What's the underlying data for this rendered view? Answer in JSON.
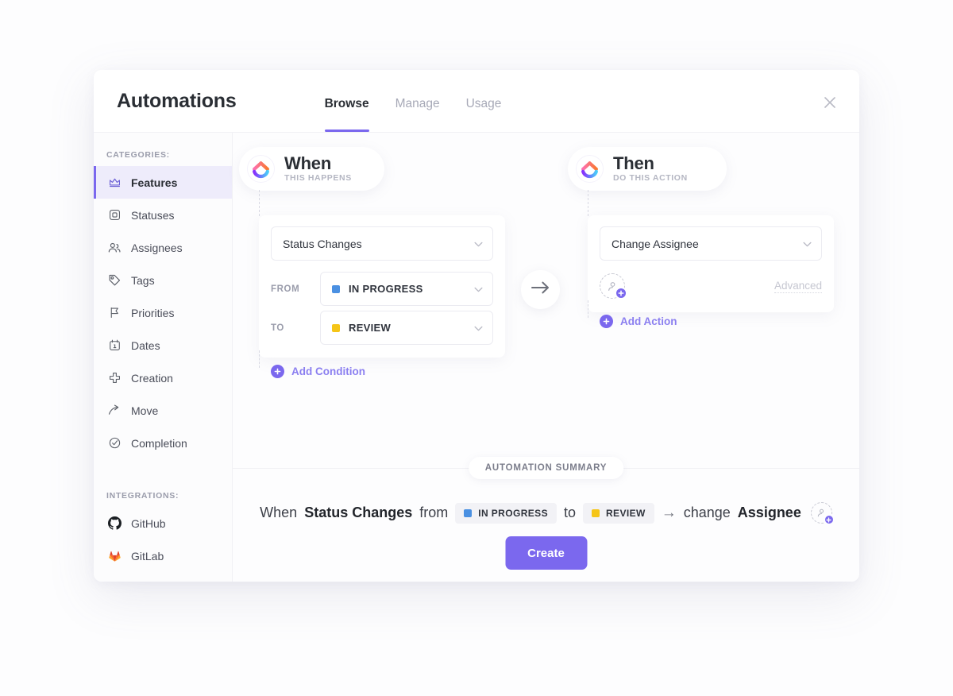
{
  "header": {
    "title": "Automations",
    "tabs": [
      {
        "label": "Browse",
        "active": true
      },
      {
        "label": "Manage",
        "active": false
      },
      {
        "label": "Usage",
        "active": false
      }
    ],
    "close_icon": "close-icon"
  },
  "sidebar": {
    "categories_label": "CATEGORIES:",
    "categories": [
      {
        "label": "Features",
        "icon": "crown-icon",
        "active": true
      },
      {
        "label": "Statuses",
        "icon": "square-outline-icon",
        "active": false
      },
      {
        "label": "Assignees",
        "icon": "people-icon",
        "active": false
      },
      {
        "label": "Tags",
        "icon": "tag-icon",
        "active": false
      },
      {
        "label": "Priorities",
        "icon": "flag-icon",
        "active": false
      },
      {
        "label": "Dates",
        "icon": "calendar-icon",
        "active": false
      },
      {
        "label": "Creation",
        "icon": "plus-cross-icon",
        "active": false
      },
      {
        "label": "Move",
        "icon": "arrow-move-icon",
        "active": false
      },
      {
        "label": "Completion",
        "icon": "check-circle-icon",
        "active": false
      }
    ],
    "integrations_label": "INTEGRATIONS:",
    "integrations": [
      {
        "label": "GitHub",
        "icon": "github-icon",
        "color": "#1b1f23"
      },
      {
        "label": "GitLab",
        "icon": "gitlab-icon",
        "color": "#e24329"
      }
    ]
  },
  "when": {
    "pill_title": "When",
    "pill_subtitle": "THIS HAPPENS",
    "logo_icon": "clickup-logo-icon",
    "trigger_value": "Status Changes",
    "conditions": [
      {
        "key": "FROM",
        "value": "IN PROGRESS",
        "color": "#4a90e2"
      },
      {
        "key": "TO",
        "value": "REVIEW",
        "color": "#f5c518"
      }
    ],
    "add_condition_label": "Add Condition"
  },
  "then": {
    "pill_title": "Then",
    "pill_subtitle": "DO THIS ACTION",
    "logo_icon": "clickup-logo-icon",
    "action_value": "Change Assignee",
    "assignee_placeholder_icon": "add-user-icon",
    "advanced_label": "Advanced",
    "add_action_label": "Add Action"
  },
  "connector": {
    "icon": "arrow-right-icon"
  },
  "summary": {
    "tag_label": "AUTOMATION SUMMARY",
    "when_word": "When",
    "trigger": "Status Changes",
    "from_word": "from",
    "from_status": {
      "label": "IN PROGRESS",
      "color": "#4a90e2"
    },
    "to_word": "to",
    "to_status": {
      "label": "REVIEW",
      "color": "#f5c518"
    },
    "arrow": "→",
    "change_word": "change",
    "action_target": "Assignee",
    "avatar_icon": "add-user-icon"
  },
  "footer": {
    "create_label": "Create"
  },
  "colors": {
    "accent": "#7b68ee",
    "accent_soft": "#eeecfb",
    "text": "#2a2e34",
    "muted": "#a7a9b7",
    "in_progress": "#4a90e2",
    "review": "#f5c518"
  }
}
